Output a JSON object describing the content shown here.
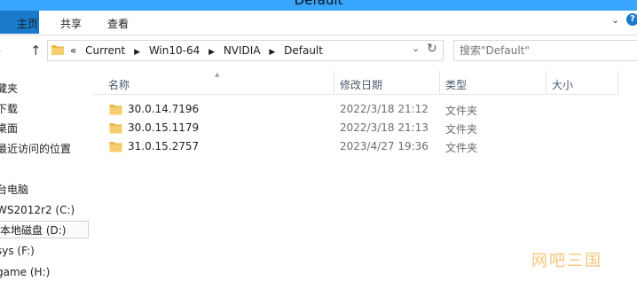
{
  "window": {
    "title": "Default"
  },
  "ribbon": {
    "tabs": [
      "主页",
      "共享",
      "查看"
    ],
    "expand_icon": "chevron-down-icon",
    "help_label": "?"
  },
  "navigation": {
    "up_icon": "up-arrow-icon",
    "breadcrumbs": [
      "Current",
      "Win10-64",
      "NVIDIA",
      "Default"
    ],
    "overflow": "«"
  },
  "search": {
    "placeholder": "搜索\"Default\""
  },
  "sidebar": {
    "items": [
      "藏夹",
      "下载",
      "桌面",
      "最近访问的位置",
      "台电脑",
      "WS2012r2 (C:)",
      "本地磁盘 (D:)",
      "sys (F:)",
      "game (H:)"
    ],
    "selected_index": 6
  },
  "columns": {
    "name": "名称",
    "modified": "修改日期",
    "type": "类型",
    "size": "大小"
  },
  "files": [
    {
      "name": "30.0.14.7196",
      "modified": "2022/3/18 21:12",
      "type": "文件夹"
    },
    {
      "name": "30.0.15.1179",
      "modified": "2022/3/18 21:13",
      "type": "文件夹"
    },
    {
      "name": "31.0.15.2757",
      "modified": "2023/4/27 19:36",
      "type": "文件夹"
    }
  ],
  "watermark": "网吧三国",
  "colors": {
    "title_bar": "#38a6ff",
    "file_tab": "#1979ca",
    "folder": "#e8b84a"
  }
}
